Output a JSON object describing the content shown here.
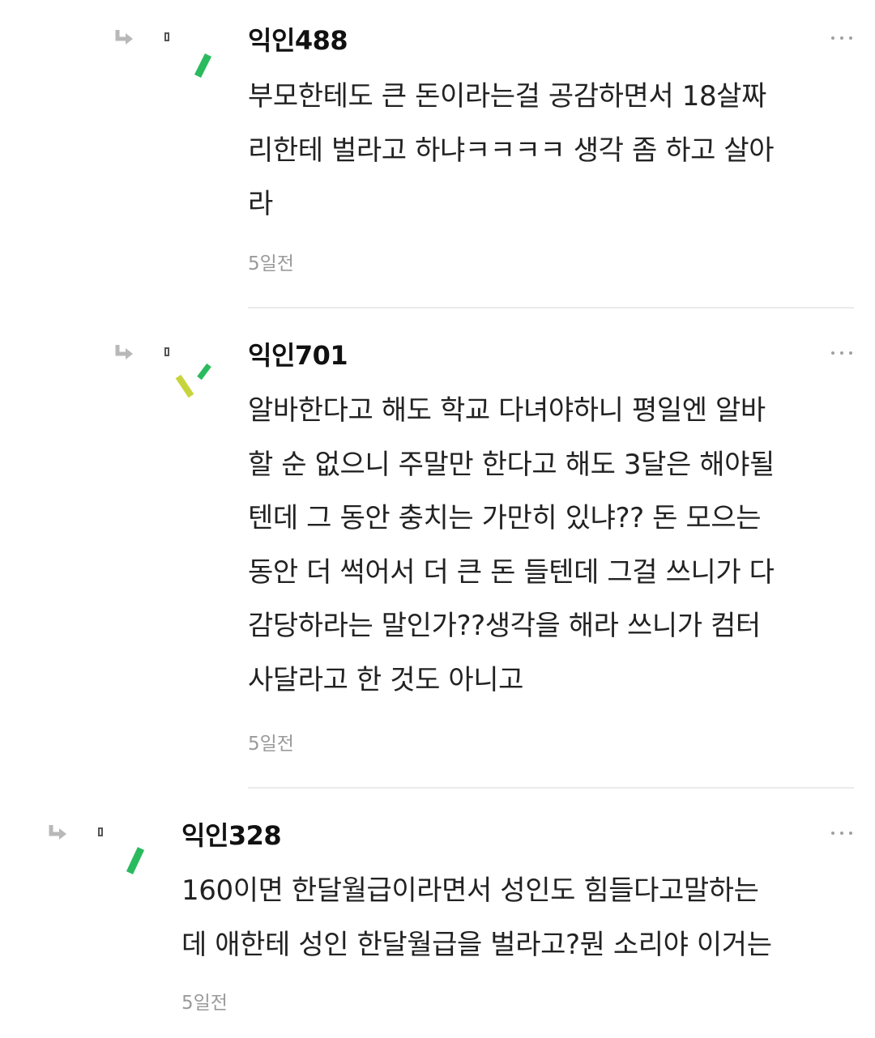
{
  "comments": [
    {
      "author": "익인488",
      "text": "부모한테도 큰 돈이라는걸 공감하면서 18살짜\n리한테 벌라고 하냐ㅋㅋㅋㅋ 생각 좀 하고 살아\n라",
      "time": "5일전",
      "avatar_icon": "green-stroke"
    },
    {
      "author": "익인701",
      "text": "알바한다고 해도 학교 다녀야하니 평일엔 알바\n할 순 없으니 주말만 한다고 해도 3달은 해야될\n텐데 그 동안 충치는 가만히 있냐?? 돈 모으는\n동안 더 썩어서 더 큰 돈 들텐데 그걸 쓰니가 다\n감당하라는 말인가??생각을 해라 쓰니가 컴터\n사달라고 한 것도 아니고",
      "time": "5일전",
      "avatar_icon": "yellow-green-strokes"
    },
    {
      "author": "익인328",
      "text": "160이면 한달월급이라면서 성인도 힘들다고말하는\n데 애한테 성인 한달월급을 벌라고?뭔 소리야 이거는",
      "time": "5일전",
      "avatar_icon": "green-stroke"
    }
  ],
  "icons": {
    "reply": "reply-arrow-icon",
    "more": "more-options-icon"
  },
  "colors": {
    "author": "#111111",
    "text": "#222222",
    "time": "#9a9a9a",
    "divider": "#ebebeb",
    "avatar_green": "#2bbb5f",
    "avatar_yellow": "#c8d43c",
    "reply_icon": "#b8b8b8"
  }
}
